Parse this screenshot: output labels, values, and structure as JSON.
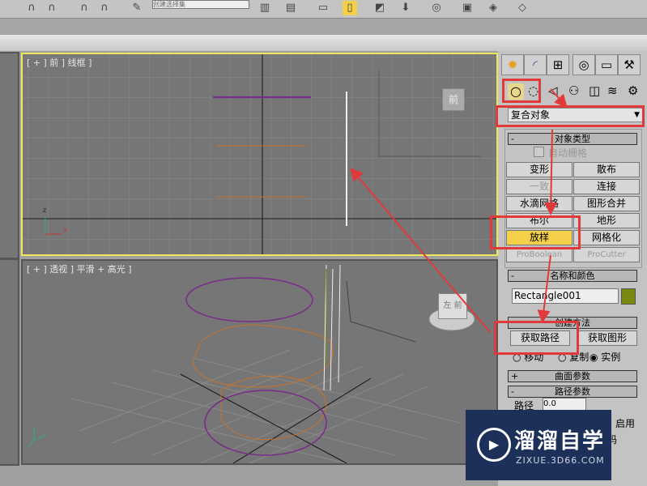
{
  "toolbar": {
    "selection_set": "创建选择集"
  },
  "viewports": {
    "front": {
      "label": "[ + ] 前 ] 线框 ]",
      "gizmo_label": "前"
    },
    "perspective": {
      "label": "[ + ] 透视 ] 平滑 + 高光 ]",
      "gizmo_label": "左 前"
    }
  },
  "panel": {
    "tabs": [
      "create",
      "modify",
      "hierarchy",
      "motion",
      "display",
      "utilities"
    ],
    "category_dropdown": "复合对象",
    "object_type": {
      "title": "对象类型",
      "sign": "-",
      "autogrid": "自动栅格",
      "buttons": [
        "变形",
        "散布",
        "一致",
        "连接",
        "水滴网格",
        "图形合并",
        "布尔",
        "地形",
        "放样",
        "网格化",
        "ProBoolean",
        "ProCutter"
      ]
    },
    "name_color": {
      "title": "名称和颜色",
      "sign": "-",
      "name": "Rectangle001",
      "color": "#7a8a10"
    },
    "creation_method": {
      "title": "创建方法",
      "get_path": "获取路径",
      "get_shape": "获取图形",
      "move": "移动",
      "copy": "复制",
      "instance": "实例"
    },
    "surface_params": {
      "title": "曲面参数",
      "sign": "+"
    },
    "path_params": {
      "title": "路径参数",
      "sign": "-",
      "path_label": "路径",
      "path_value": "0.0",
      "enable": "启用",
      "partial": "码"
    }
  },
  "watermark": {
    "title": "溜溜自学",
    "url": "ZIXUE.3D66.COM"
  },
  "colors": {
    "accent": "#f3cf4a",
    "annotation": "#e23a3a"
  }
}
